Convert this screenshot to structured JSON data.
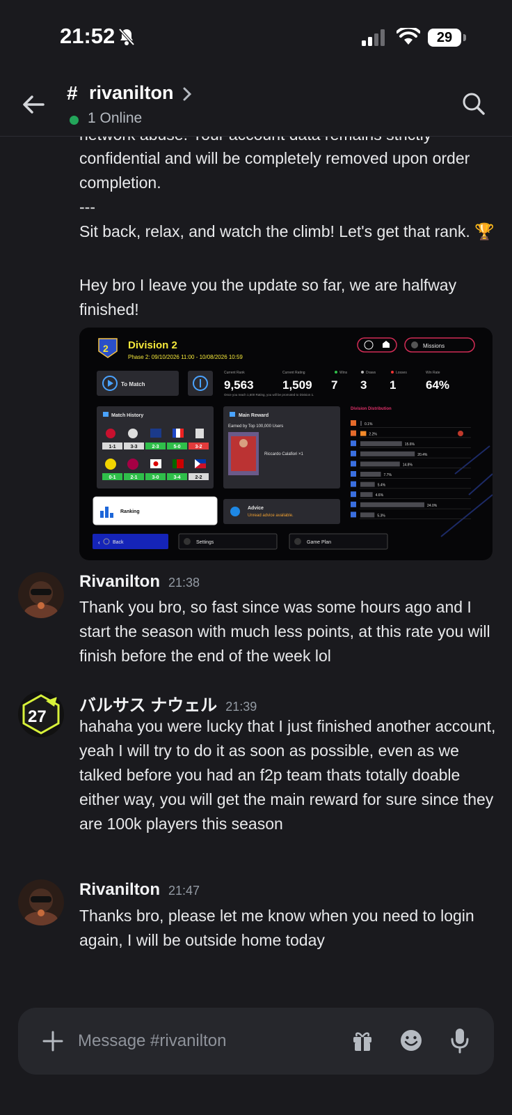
{
  "status_bar": {
    "time": "21:52",
    "battery": "29"
  },
  "header": {
    "hash": "#",
    "channel": "rivanilton",
    "online": "1 Online"
  },
  "messages": {
    "continuation": {
      "line_cut": "network abuse. Your account data remains strictly",
      "text": "confidential and will be completely removed upon order completion.",
      "separator": "---",
      "text2": "Sit back, relax, and watch the climb! Let's get that rank. 🏆",
      "text3": "Hey bro I leave you the update so far, we are halfway finished!"
    },
    "embed": {
      "division": "Division 2",
      "phase": "Phase 2: 09/10/2026 11:00 - 10/08/2026 10:59",
      "missions": "Missions",
      "to_match": "To Match",
      "current_rank_label": "Current Rank",
      "current_rank": "9,563",
      "current_rating_label": "Current Rating",
      "current_rating": "1,509",
      "wins_label": "Wins",
      "wins": "7",
      "draws_label": "Draws",
      "draws": "3",
      "losses_label": "Losses",
      "losses": "1",
      "win_rate_label": "Win Rate",
      "win_rate": "64%",
      "promo_note": "Once you reach 1,600 Rating, you will be promoted to Division 1.",
      "match_history": "Match History",
      "scores_row1": [
        "1-1",
        "3-3",
        "2-3",
        "5-0",
        "3-2"
      ],
      "scores_row2": [
        "0-1",
        "2-1",
        "3-0",
        "3-4",
        "2-2"
      ],
      "main_reward": "Main Reward",
      "earned": "Earned by Top 100,000 Users",
      "player": "Riccardo Calafiori ×1",
      "distribution_title": "Division Distribution",
      "distribution": [
        "0.1%",
        "2.2%",
        "15.6%",
        "20.4%",
        "14.8%",
        "7.7%",
        "5.4%",
        "4.6%",
        "24.0%",
        "5.3%"
      ],
      "ranking": "Ranking",
      "advice": "Advice",
      "advice_sub": "Unread advice available.",
      "back": "Back",
      "settings": "Settings",
      "game_plan": "Game Plan"
    },
    "m1": {
      "author": "Rivanilton",
      "time": "21:38",
      "text": "Thank you bro, so fast since was some hours ago and I start the season with much less points, at this rate you will finish before the end of the week lol"
    },
    "m2": {
      "author": "バルサス ナウェル",
      "time": "21:39",
      "text": "hahaha you were lucky that I just finished another account, yeah I will try to do it as soon as possible, even as we talked before you had an f2p team thats totally doable either way, you will get the main reward for sure since they are 100k players this season"
    },
    "m3": {
      "author": "Rivanilton",
      "time": "21:47",
      "text": "Thanks bro, please let me know when you need to login again, I will be outside home today"
    }
  },
  "composer": {
    "placeholder": "Message #rivanilton"
  },
  "colors": {
    "background": "#1a1a1e",
    "online": "#23a55a",
    "accent_yellow": "#f5e83a"
  }
}
